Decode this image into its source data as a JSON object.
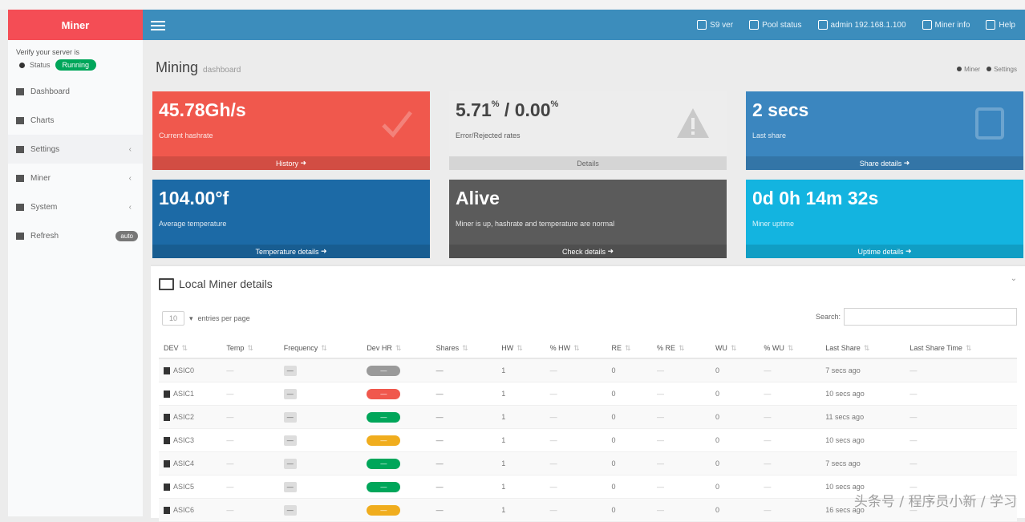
{
  "brand": {
    "name": "Miner"
  },
  "topnav": [
    {
      "icon": "cpu-icon",
      "label": "S9 ver"
    },
    {
      "icon": "pool-icon",
      "label": "Pool status"
    },
    {
      "icon": "user-icon",
      "label": "admin 192.168.1.100"
    },
    {
      "icon": "info-icon",
      "label": "Miner info"
    },
    {
      "icon": "help-icon",
      "label": "Help"
    }
  ],
  "sidebar": {
    "notice": "Verify your server is",
    "status_label": "Status",
    "status_badge": "Running",
    "items": [
      {
        "icon": "dashboard-icon",
        "label": "Dashboard",
        "chevron": "",
        "badge": ""
      },
      {
        "icon": "charts-icon",
        "label": "Charts",
        "chevron": "",
        "badge": ""
      },
      {
        "icon": "settings-icon",
        "label": "Settings",
        "chevron": "‹",
        "badge": ""
      },
      {
        "icon": "miner-icon",
        "label": "Miner",
        "chevron": "‹",
        "badge": ""
      },
      {
        "icon": "system-icon",
        "label": "System",
        "chevron": "‹",
        "badge": ""
      },
      {
        "icon": "refresh-icon",
        "label": "Refresh",
        "chevron": "",
        "badge": "auto"
      }
    ]
  },
  "page": {
    "title": "Mining",
    "subtitle": "dashboard",
    "crumb_home": "Miner",
    "crumb_current": "Settings"
  },
  "cards": [
    {
      "value": "45.78Gh/s",
      "sub": "Current hashrate",
      "foot": "History",
      "color": "#f0584d"
    },
    {
      "value_a": "5.71",
      "sup_a": "%",
      "sep": " / ",
      "value_b": "0.00",
      "sup_b": "%",
      "sub": "Error/Rejected rates",
      "foot": "Details",
      "color": "#ededed"
    },
    {
      "value": "2 secs",
      "sub": "Last share",
      "foot": "Share details",
      "color": "#3b86bf"
    },
    {
      "value": "104.00°f",
      "sub": "Average temperature",
      "foot": "Temperature details",
      "color": "#1c6aa6"
    },
    {
      "value": "Alive",
      "sub": "Miner is up, hashrate and temperature are normal",
      "foot": "Check details",
      "color": "#5b5b5b"
    },
    {
      "value": "0d 0h 14m 32s",
      "sub": "Miner uptime",
      "foot": "Uptime details",
      "color": "#13b4e0"
    }
  ],
  "panel": {
    "title": "Local Miner details",
    "show_value": "10",
    "show_suffix": "entries per page",
    "search_label": "Search:",
    "columns": [
      "DEV",
      "Temp",
      "Frequency",
      "Dev HR",
      "Shares",
      "HW",
      "% HW",
      "RE",
      "% RE",
      "WU",
      "% WU",
      "Last Share",
      "Last Share Time"
    ],
    "rows": [
      {
        "dev": "ASIC0",
        "temp": "—",
        "freq": "—",
        "hr": "—",
        "hr_color": "#9a9a9a",
        "shares": "—",
        "hw": "1",
        "phw": "—",
        "re": "0",
        "pre": "—",
        "wu": "0",
        "pwu": "—",
        "last": "7 secs ago",
        "time": "—"
      },
      {
        "dev": "ASIC1",
        "temp": "—",
        "freq": "—",
        "hr": "—",
        "hr_color": "#f0584d",
        "shares": "—",
        "hw": "1",
        "phw": "—",
        "re": "0",
        "pre": "—",
        "wu": "0",
        "pwu": "—",
        "last": "10 secs ago",
        "time": "—"
      },
      {
        "dev": "ASIC2",
        "temp": "—",
        "freq": "—",
        "hr": "—",
        "hr_color": "#00a65a",
        "shares": "—",
        "hw": "1",
        "phw": "—",
        "re": "0",
        "pre": "—",
        "wu": "0",
        "pwu": "—",
        "last": "11 secs ago",
        "time": "—"
      },
      {
        "dev": "ASIC3",
        "temp": "—",
        "freq": "—",
        "hr": "—",
        "hr_color": "#f0ad1e",
        "shares": "—",
        "hw": "1",
        "phw": "—",
        "re": "0",
        "pre": "—",
        "wu": "0",
        "pwu": "—",
        "last": "10 secs ago",
        "time": "—"
      },
      {
        "dev": "ASIC4",
        "temp": "—",
        "freq": "—",
        "hr": "—",
        "hr_color": "#00a65a",
        "shares": "—",
        "hw": "1",
        "phw": "—",
        "re": "0",
        "pre": "—",
        "wu": "0",
        "pwu": "—",
        "last": "7 secs ago",
        "time": "—"
      },
      {
        "dev": "ASIC5",
        "temp": "—",
        "freq": "—",
        "hr": "—",
        "hr_color": "#00a65a",
        "shares": "—",
        "hw": "1",
        "phw": "—",
        "re": "0",
        "pre": "—",
        "wu": "0",
        "pwu": "—",
        "last": "10 secs ago",
        "time": "—"
      },
      {
        "dev": "ASIC6",
        "temp": "—",
        "freq": "—",
        "hr": "—",
        "hr_color": "#f0ad1e",
        "shares": "—",
        "hw": "1",
        "phw": "—",
        "re": "0",
        "pre": "—",
        "wu": "0",
        "pwu": "—",
        "last": "16 secs ago",
        "time": "—"
      }
    ]
  },
  "watermark": "头条号 / 程序员小新 / 学习"
}
